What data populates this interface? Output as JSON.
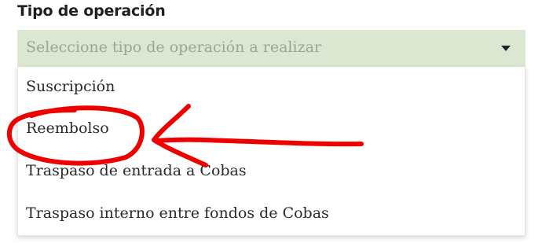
{
  "form": {
    "label": "Tipo de operación",
    "select": {
      "placeholder": "Seleccione tipo de operación a realizar",
      "caret_icon": "caret-down-icon",
      "background_color": "#dce7d2"
    },
    "options": [
      {
        "label": "Suscripción"
      },
      {
        "label": "Reembolso"
      },
      {
        "label": "Traspaso de entrada a Cobas"
      },
      {
        "label": "Traspaso interno entre fondos de Cobas"
      }
    ]
  },
  "annotation": {
    "color": "#ee0000",
    "highlighted_option": "Reembolso",
    "shapes": [
      "circle",
      "arrow"
    ]
  }
}
